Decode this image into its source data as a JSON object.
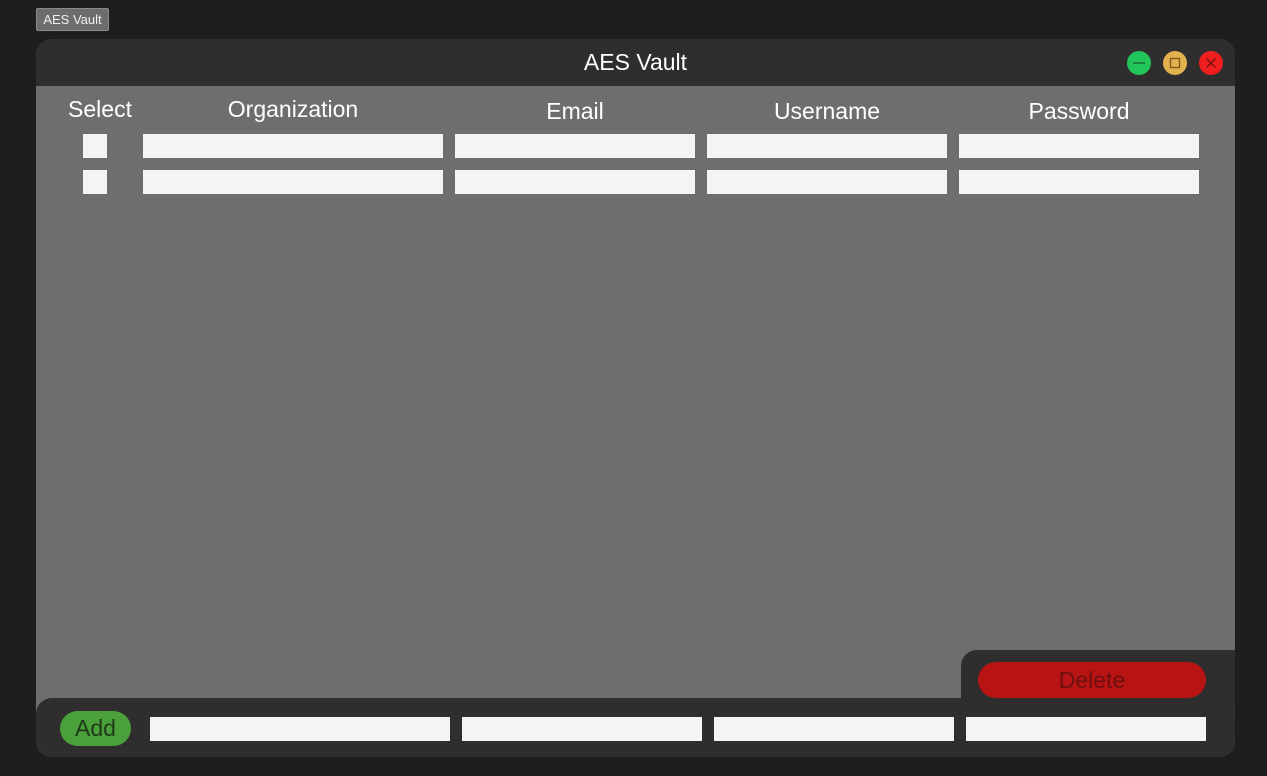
{
  "taskbar": {
    "label": "AES Vault"
  },
  "window": {
    "title": "AES Vault",
    "controls": {
      "minimize_color": "#22c55a",
      "maximize_color": "#e2b04e",
      "close_color": "#f01e1e"
    }
  },
  "table": {
    "headers": {
      "select": "Select",
      "organization": "Organization",
      "email": "Email",
      "username": "Username",
      "password": "Password"
    },
    "rows": [
      {
        "selected": false,
        "organization": "",
        "email": "",
        "username": "",
        "password": ""
      },
      {
        "selected": false,
        "organization": "",
        "email": "",
        "username": "",
        "password": ""
      }
    ]
  },
  "actions": {
    "delete_label": "Delete",
    "add_label": "Add"
  },
  "new_entry": {
    "organization": "",
    "email": "",
    "username": "",
    "password": ""
  },
  "colors": {
    "background": "#1e1e1e",
    "window_body": "#6e6e6e",
    "title_bar": "#2f2d2e",
    "delete_button": "#b81414",
    "add_button": "#4aa03a"
  }
}
